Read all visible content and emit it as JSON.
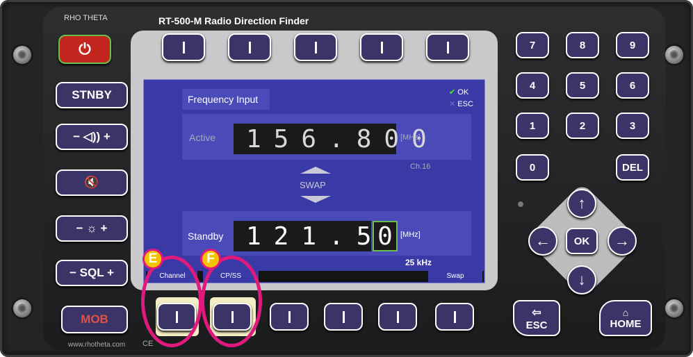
{
  "device": {
    "title": "RT-500-M Radio Direction Finder",
    "logo_text": "RHO THETA",
    "website": "www.rhotheta.com",
    "ce_mark": "CE"
  },
  "left_keys": {
    "power": "⏻",
    "stnby": "STNBY",
    "volume": "− ◁)) +",
    "mute": "🔇",
    "brightness": "− ☼ +",
    "sql": "− SQL +",
    "mob": "MOB"
  },
  "screen": {
    "heading": "Frequency Input",
    "ok_label": "OK",
    "esc_label": "ESC",
    "active_label": "Active",
    "active_freq": "156.800",
    "active_unit": "[MHz]",
    "channel": "Ch.16",
    "swap_label": "SWAP",
    "standby_label": "Standby",
    "standby_freq_main": "121.50",
    "standby_freq_cursor": "0",
    "standby_unit": "[MHz]",
    "step": "25 kHz",
    "softkey_labels": [
      "Channel",
      "CP/SS",
      "",
      "",
      "",
      "Swap"
    ]
  },
  "annotations": {
    "e_label": "E",
    "f_label": "F"
  },
  "numpad": {
    "keys": [
      "7",
      "8",
      "9",
      "4",
      "5",
      "6",
      "1",
      "2",
      "3"
    ],
    "zero": "0",
    "del": "DEL"
  },
  "nav": {
    "up": "↑",
    "down": "↓",
    "left": "←",
    "right": "→",
    "ok": "OK",
    "esc": "ESC",
    "home": "HOME"
  },
  "colors": {
    "screen_bg": "#3a3aa6",
    "key_bg": "#3a3566",
    "highlight_circle": "#e0197d",
    "badge": "#f5c400",
    "power_key": "#c2261e"
  }
}
